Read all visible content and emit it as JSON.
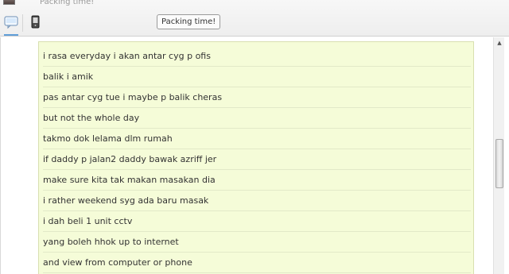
{
  "header": {
    "top_status": "Packing time!",
    "status_pill": "Packing time!",
    "tabs": [
      {
        "name": "chat",
        "icon": "chat-window-icon",
        "active": true
      },
      {
        "name": "mobile",
        "icon": "mobile-phone-icon",
        "active": false
      }
    ]
  },
  "messages": [
    "i rasa everyday i akan antar cyg p ofis",
    "balik i amik",
    "pas antar cyg tue i maybe p balik cheras",
    "but not the whole day",
    "takmo dok lelama dlm rumah",
    "if daddy p jalan2 daddy bawak azriff jer",
    "make sure kita tak makan masakan dia",
    "i rather weekend syg ada baru masak",
    "i dah beli 1 unit cctv",
    "yang boleh hhok up to internet",
    "and view from computer or phone"
  ],
  "colors": {
    "panel_bg": "#f5fcd8",
    "panel_border": "#d8e0b0",
    "active_tab_indicator": "#5f9ed8"
  }
}
